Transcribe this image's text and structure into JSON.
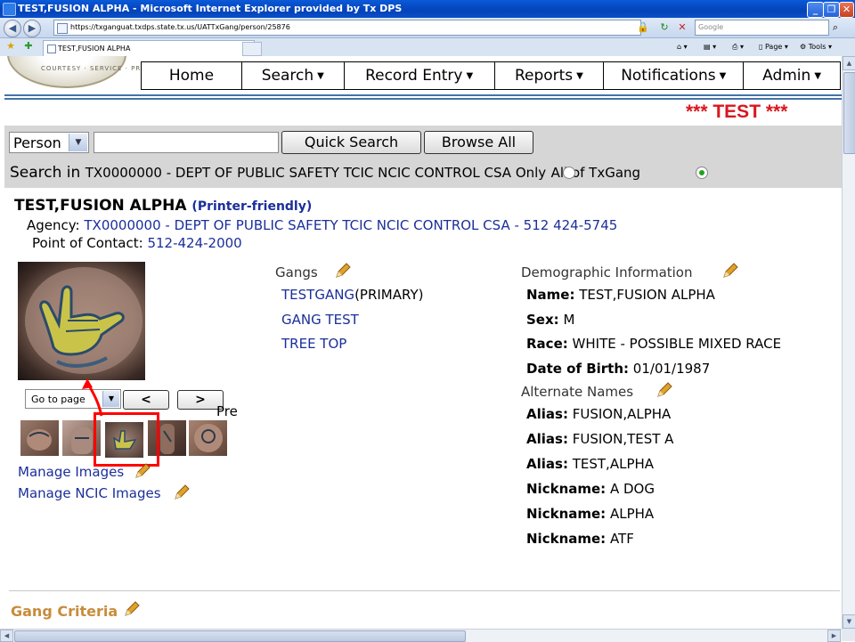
{
  "window": {
    "title": "TEST,FUSION ALPHA - Microsoft Internet Explorer provided by Tx DPS"
  },
  "browser": {
    "url": "https://txganguat.txdps.state.tx.us/UATTxGang/person/25876",
    "search_placeholder": "Google",
    "tab_title": "TEST,FUSION ALPHA",
    "toolbar": {
      "page_label": "Page",
      "tools_label": "Tools"
    }
  },
  "nav": {
    "items": [
      {
        "label": "Home",
        "has_caret": false
      },
      {
        "label": "Search",
        "has_caret": true
      },
      {
        "label": "Record Entry",
        "has_caret": true
      },
      {
        "label": "Reports",
        "has_caret": true
      },
      {
        "label": "Notifications",
        "has_caret": true
      },
      {
        "label": "Admin",
        "has_caret": true
      }
    ]
  },
  "seal_text": "COURTESY · SERVICE · PROTECTION",
  "banner": "*** TEST ***",
  "search": {
    "type_value": "Person",
    "query_value": "",
    "quick_search_label": "Quick Search",
    "browse_all_label": "Browse All",
    "search_in_label": "Search in",
    "agency_option": "TX0000000 - DEPT OF PUBLIC SAFETY TCIC NCIC CONTROL CSA Only",
    "all_option": "All of TxGang",
    "selected_scope": "all"
  },
  "person": {
    "name": "TEST,FUSION ALPHA",
    "printer_friendly": "(Printer-friendly)",
    "agency_label": "Agency:",
    "agency_value": "TX0000000 - DEPT OF PUBLIC SAFETY TCIC NCIC CONTROL CSA - 512 424-5745",
    "contact_label": "Point of Contact:",
    "contact_value": "512-424-2000"
  },
  "images": {
    "goto_label": "Go to page",
    "prev_btn": "<",
    "next_btn": ">",
    "prev_text": "Pre",
    "thumbnails": [
      "torso-tattoo",
      "chest-tattoo",
      "hand-sign-tattoo",
      "arm-tattoo",
      "back-tattoo"
    ],
    "selected_index": 2,
    "manage_images": "Manage Images",
    "manage_ncic": "Manage NCIC Images"
  },
  "gangs": {
    "heading": "Gangs",
    "items": [
      {
        "name": "TESTGANG",
        "suffix": "(PRIMARY)"
      },
      {
        "name": "GANG TEST",
        "suffix": ""
      },
      {
        "name": "TREE TOP",
        "suffix": ""
      }
    ]
  },
  "demographics": {
    "heading": "Demographic Information",
    "name_label": "Name:",
    "name_value": "TEST,FUSION ALPHA",
    "sex_label": "Sex:",
    "sex_value": "M",
    "race_label": "Race:",
    "race_value": "WHITE - POSSIBLE MIXED RACE",
    "dob_label": "Date of Birth:",
    "dob_value": "01/01/1987"
  },
  "alternate_names": {
    "heading": "Alternate Names",
    "items": [
      {
        "label": "Alias:",
        "value": "FUSION,ALPHA"
      },
      {
        "label": "Alias:",
        "value": "FUSION,TEST A"
      },
      {
        "label": "Alias:",
        "value": "TEST,ALPHA"
      },
      {
        "label": "Nickname:",
        "value": "A DOG"
      },
      {
        "label": "Nickname:",
        "value": "ALPHA"
      },
      {
        "label": "Nickname:",
        "value": "ATF"
      }
    ]
  },
  "gang_criteria": {
    "heading": "Gang Criteria"
  },
  "colors": {
    "accent_red": "#ff0000",
    "link_blue": "#1b2f9a",
    "banner_red": "#d8181e",
    "criteria_gold": "#c88c3c",
    "pencil_gold": "#e0a22a"
  },
  "icons": [
    "ie-icon",
    "back-icon",
    "forward-icon",
    "lock-icon",
    "refresh-icon",
    "stop-icon",
    "search-icon",
    "favorites-star-icon",
    "home-icon",
    "feeds-icon",
    "print-icon",
    "pencil-edit-icon",
    "chevron-left-icon",
    "chevron-right-icon",
    "chevron-down-icon"
  ]
}
